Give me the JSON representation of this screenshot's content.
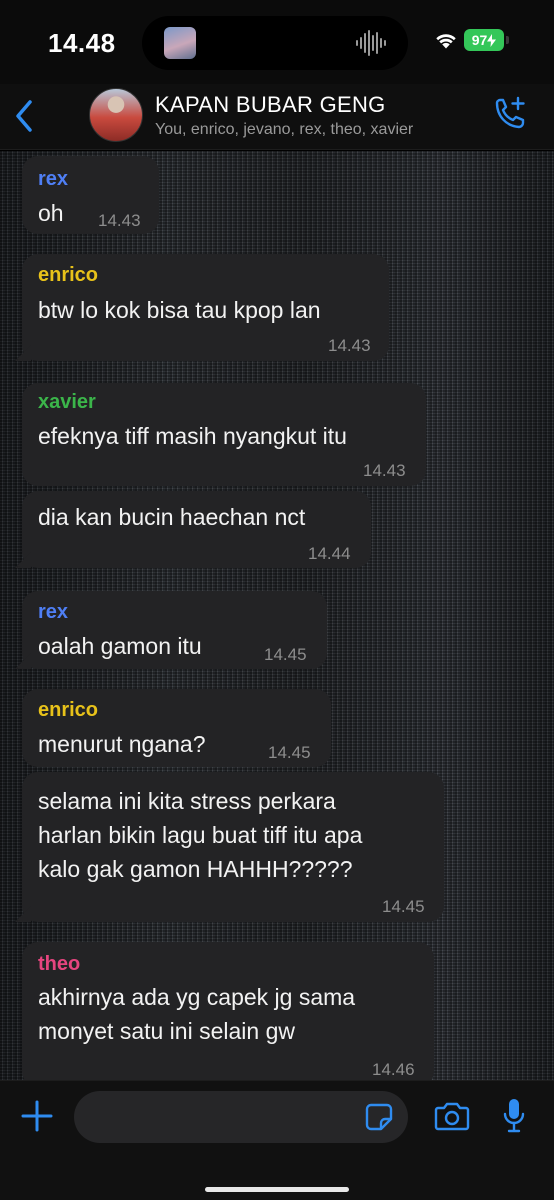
{
  "status_bar": {
    "time": "14.48",
    "battery": "97"
  },
  "header": {
    "group_name": "KAPAN BUBAR GENG",
    "members": "You, enrico, jevano, rex, theo, xavier"
  },
  "colors": {
    "accent": "#2f8cf0",
    "rex": "#4f7ff5",
    "enrico": "#e8c21a",
    "xavier": "#3bb54a",
    "theo": "#e6457f"
  },
  "icons": {
    "back": "chevron-left-icon",
    "call": "phone-plus-icon",
    "add": "plus-icon",
    "sticker": "sticker-icon",
    "camera": "camera-icon",
    "mic": "microphone-icon"
  },
  "messages": [
    {
      "sender": "rex",
      "lines": [
        "oh"
      ],
      "time": "14.43"
    },
    {
      "sender": "enrico",
      "lines": [
        "btw lo kok bisa tau kpop lan"
      ],
      "time": "14.43"
    },
    {
      "sender": "xavier",
      "lines": [
        "efeknya tiff masih nyangkut itu"
      ],
      "time": "14.43"
    },
    {
      "sender": "",
      "lines": [
        "dia kan bucin haechan nct"
      ],
      "time": "14.44"
    },
    {
      "sender": "rex",
      "lines": [
        "oalah gamon itu"
      ],
      "time": "14.45"
    },
    {
      "sender": "enrico",
      "lines": [
        "menurut ngana?"
      ],
      "time": "14.45"
    },
    {
      "sender": "",
      "lines": [
        "selama ini kita stress perkara",
        "harlan bikin lagu buat tiff itu apa",
        "kalo gak gamon HAHHH?????"
      ],
      "time": "14.45"
    },
    {
      "sender": "theo",
      "lines": [
        "akhirnya ada yg capek jg sama",
        "monyet satu ini selain gw"
      ],
      "time": "14.46"
    }
  ],
  "input": {
    "placeholder": ""
  }
}
